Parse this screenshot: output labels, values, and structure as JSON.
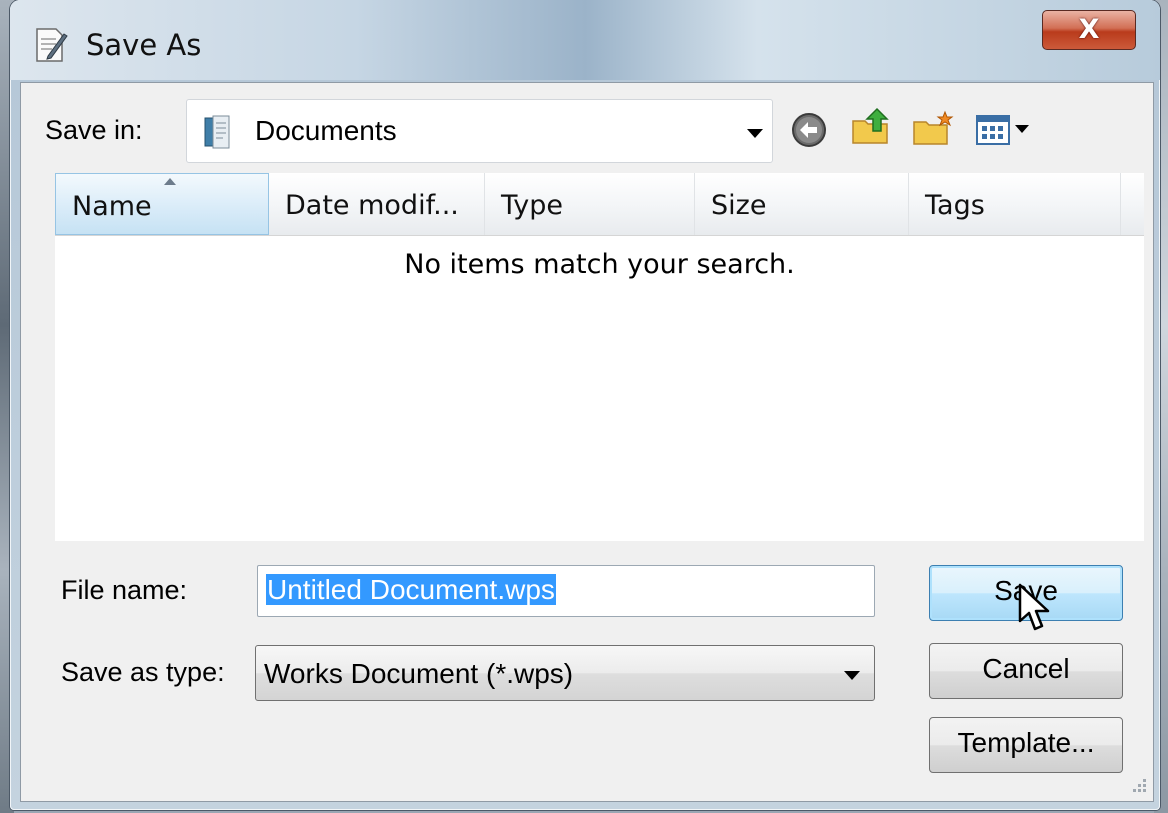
{
  "window": {
    "title": "Save As",
    "close_label": "X"
  },
  "save_in": {
    "label": "Save in:",
    "value": "Documents"
  },
  "toolbar": {
    "icons": [
      "back-icon",
      "up-folder-icon",
      "new-folder-icon",
      "views-menu-icon"
    ]
  },
  "file_list": {
    "columns": [
      "Name",
      "Date modif...",
      "Type",
      "Size",
      "Tags"
    ],
    "sorted_column": "Name",
    "empty_message": "No items match your search."
  },
  "file_name": {
    "label": "File name:",
    "value": "Untitled Document.wps"
  },
  "save_as_type": {
    "label": "Save as type:",
    "value": "Works Document (*.wps)"
  },
  "buttons": {
    "save": "Save",
    "cancel": "Cancel",
    "template": "Template..."
  },
  "colors": {
    "selection": "#3399ff",
    "close_button": "#c8492a",
    "default_button": "#bee6fd"
  }
}
